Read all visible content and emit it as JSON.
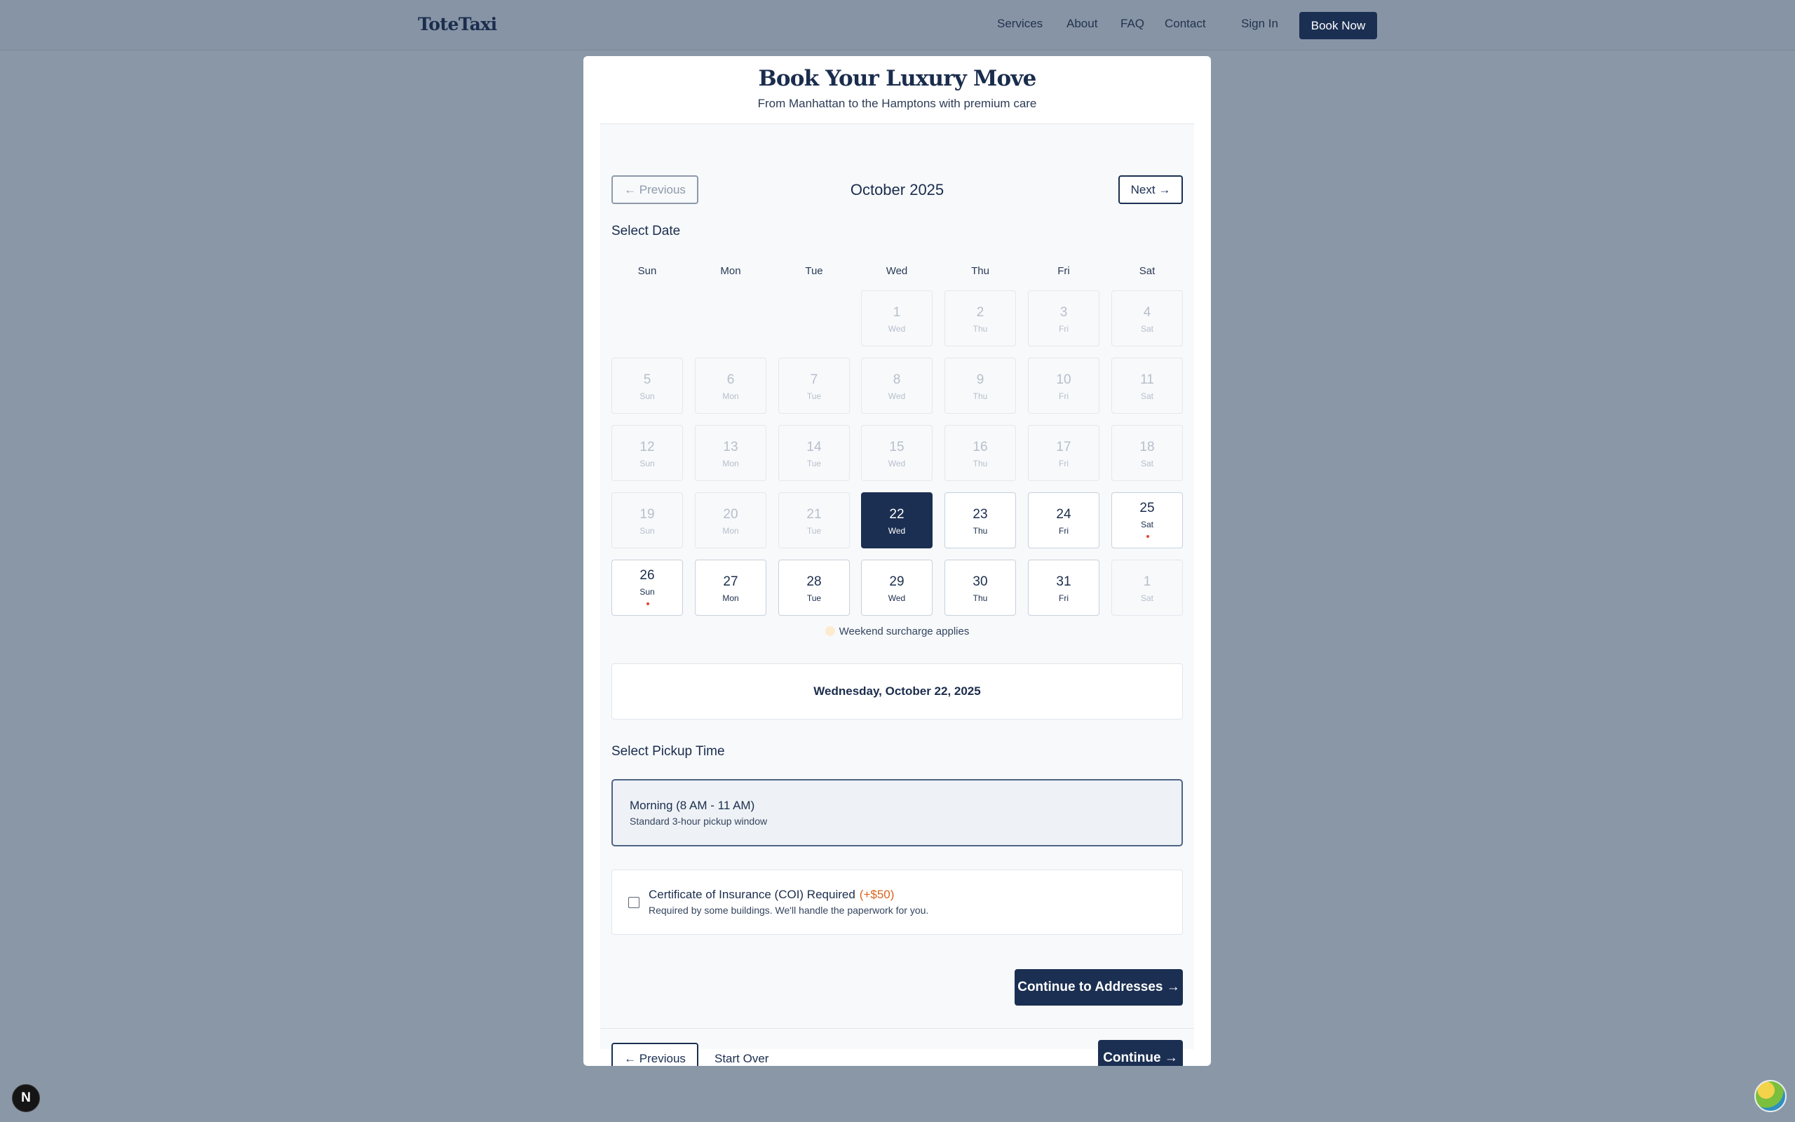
{
  "nav": {
    "logo": "ToteTaxi",
    "links": [
      "Services",
      "About",
      "FAQ",
      "Contact",
      "Sign In"
    ],
    "cta": "Book Now"
  },
  "modal": {
    "title": "Book Your Luxury Move",
    "subtitle": "From Manhattan to the Hamptons with premium care"
  },
  "calendar": {
    "prev_label": "← Previous",
    "next_label": "Next →",
    "month": "October 2025",
    "section_label": "Select Date",
    "weekdays": [
      "Sun",
      "Mon",
      "Tue",
      "Wed",
      "Thu",
      "Fri",
      "Sat"
    ],
    "days": [
      {
        "num": "1",
        "dow": "Wed",
        "state": "disabled",
        "surcharge": false
      },
      {
        "num": "2",
        "dow": "Thu",
        "state": "disabled",
        "surcharge": false
      },
      {
        "num": "3",
        "dow": "Fri",
        "state": "disabled",
        "surcharge": false
      },
      {
        "num": "4",
        "dow": "Sat",
        "state": "disabled",
        "surcharge": false
      },
      {
        "num": "5",
        "dow": "Sun",
        "state": "disabled",
        "surcharge": false
      },
      {
        "num": "6",
        "dow": "Mon",
        "state": "disabled",
        "surcharge": false
      },
      {
        "num": "7",
        "dow": "Tue",
        "state": "disabled",
        "surcharge": false
      },
      {
        "num": "8",
        "dow": "Wed",
        "state": "disabled",
        "surcharge": false
      },
      {
        "num": "9",
        "dow": "Thu",
        "state": "disabled",
        "surcharge": false
      },
      {
        "num": "10",
        "dow": "Fri",
        "state": "disabled",
        "surcharge": false
      },
      {
        "num": "11",
        "dow": "Sat",
        "state": "disabled",
        "surcharge": false
      },
      {
        "num": "12",
        "dow": "Sun",
        "state": "disabled",
        "surcharge": false
      },
      {
        "num": "13",
        "dow": "Mon",
        "state": "disabled",
        "surcharge": false
      },
      {
        "num": "14",
        "dow": "Tue",
        "state": "disabled",
        "surcharge": false
      },
      {
        "num": "15",
        "dow": "Wed",
        "state": "disabled",
        "surcharge": false
      },
      {
        "num": "16",
        "dow": "Thu",
        "state": "disabled",
        "surcharge": false
      },
      {
        "num": "17",
        "dow": "Fri",
        "state": "disabled",
        "surcharge": false
      },
      {
        "num": "18",
        "dow": "Sat",
        "state": "disabled",
        "surcharge": false
      },
      {
        "num": "19",
        "dow": "Sun",
        "state": "disabled",
        "surcharge": false
      },
      {
        "num": "20",
        "dow": "Mon",
        "state": "disabled",
        "surcharge": false
      },
      {
        "num": "21",
        "dow": "Tue",
        "state": "disabled",
        "surcharge": false
      },
      {
        "num": "22",
        "dow": "Wed",
        "state": "selected",
        "surcharge": false
      },
      {
        "num": "23",
        "dow": "Thu",
        "state": "available",
        "surcharge": false
      },
      {
        "num": "24",
        "dow": "Fri",
        "state": "available",
        "surcharge": false
      },
      {
        "num": "25",
        "dow": "Sat",
        "state": "available",
        "surcharge": true
      },
      {
        "num": "26",
        "dow": "Sun",
        "state": "available",
        "surcharge": true
      },
      {
        "num": "27",
        "dow": "Mon",
        "state": "available",
        "surcharge": false
      },
      {
        "num": "28",
        "dow": "Tue",
        "state": "available",
        "surcharge": false
      },
      {
        "num": "29",
        "dow": "Wed",
        "state": "available",
        "surcharge": false
      },
      {
        "num": "30",
        "dow": "Thu",
        "state": "available",
        "surcharge": false
      },
      {
        "num": "31",
        "dow": "Fri",
        "state": "available",
        "surcharge": false
      },
      {
        "num": "1",
        "dow": "Sat",
        "state": "disabled",
        "surcharge": false
      }
    ],
    "legend": "Weekend surcharge applies",
    "selected_date": "Wednesday, October 22, 2025"
  },
  "pickup": {
    "section_label": "Select Pickup Time",
    "option_title": "Morning (8 AM - 11 AM)",
    "option_sub": "Standard 3-hour pickup window"
  },
  "coi": {
    "checked": false,
    "title": "Certificate of Insurance (COI) Required",
    "price": "(+$50)",
    "sub": "Required by some buildings. We'll handle the paperwork for you."
  },
  "actions": {
    "continue_addresses": "Continue to Addresses →",
    "previous": "← Previous",
    "start_over": "Start Over",
    "continue": "Continue →"
  },
  "badges": {
    "next_dev": "N"
  },
  "colors": {
    "navy": "#1b2f52",
    "surcharge_dot": "#e0452f",
    "price_orange": "#d9641e",
    "legend_dot": "#fdebcf"
  }
}
